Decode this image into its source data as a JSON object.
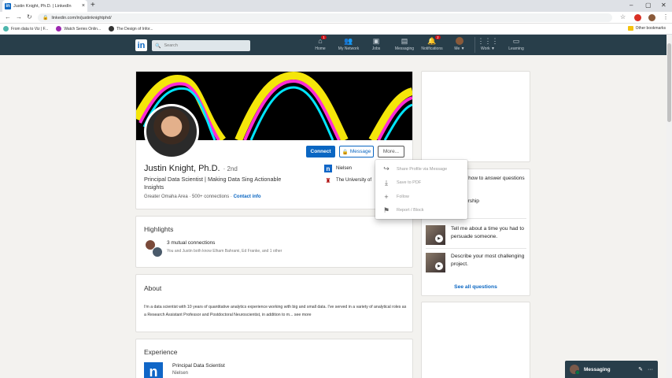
{
  "browser": {
    "tab_title": "Justin Knight, Ph.D. | LinkedIn",
    "tab_close": "×",
    "new_tab": "+",
    "url": "linkedin.com/in/justinknightphd/",
    "bookmarks": [
      "From data to Viz | F...",
      "Watch Series Onlin...",
      "The Design of Infor..."
    ],
    "bookmark_colors": [
      "#4db6ac",
      "#9c27b0",
      "#333333"
    ],
    "other_bookmarks": "Other bookmarks",
    "window_min": "–",
    "window_max": "▢",
    "window_close": "✕"
  },
  "nav": {
    "logo": "in",
    "search_placeholder": "Search",
    "items": [
      {
        "label": "Home",
        "icon": "home-icon",
        "badge": "1"
      },
      {
        "label": "My Network",
        "icon": "network-icon",
        "badge": ""
      },
      {
        "label": "Jobs",
        "icon": "jobs-icon",
        "badge": ""
      },
      {
        "label": "Messaging",
        "icon": "messaging-icon",
        "badge": ""
      },
      {
        "label": "Notifications",
        "icon": "bell-icon",
        "badge": "2"
      },
      {
        "label": "Me ▼",
        "icon": "avatar-icon",
        "badge": ""
      },
      {
        "label": "Work ▼",
        "icon": "grid-icon",
        "badge": ""
      },
      {
        "label": "Learning",
        "icon": "learning-icon",
        "badge": ""
      }
    ]
  },
  "profile": {
    "name": "Justin Knight, Ph.D.",
    "degree": "· 2nd",
    "headline": "Principal Data Scientist | Making Data Sing Actionable Insights",
    "location": "Greater Omaha Area",
    "connections": "500+ connections",
    "contact_info": "Contact info",
    "company": "Nielsen",
    "school": "The University of",
    "connect_label": "Connect",
    "message_label": "Message",
    "more_label": "More..."
  },
  "dropdown": [
    {
      "label": "Share Profile via Message",
      "icon": "share-icon"
    },
    {
      "label": "Save to PDF",
      "icon": "download-icon"
    },
    {
      "label": "Follow",
      "icon": "plus-icon"
    },
    {
      "label": "Report / Block",
      "icon": "flag-icon"
    }
  ],
  "highlights": {
    "title": "Highlights",
    "mutual_title": "3 mutual connections",
    "mutual_desc": "You and Justin both know Elham Bahrami, Ed Franke, and 1 other"
  },
  "about": {
    "title": "About",
    "text": "I'm a data scientist with 10 years of quantitative analytics experience working with big and small data. I've served in a variety of analytical roles as a Research Assistant Professor and Postdoctoral Neuroscientist, in addition to m... ",
    "see_more": "see more"
  },
  "experience": {
    "title": "Experience",
    "role": "Principal Data Scientist",
    "company": "Nielsen",
    "logo": "n"
  },
  "ask": {
    "intro": "experts how to answer questions",
    "partial_q": "be your leadership",
    "questions": [
      "Tell me about a time you had to persuade someone.",
      "Describe your most challenging project."
    ],
    "see_all": "See all questions"
  },
  "messaging": {
    "label": "Messaging",
    "compose_icon": "✎",
    "more_icon": "···"
  }
}
